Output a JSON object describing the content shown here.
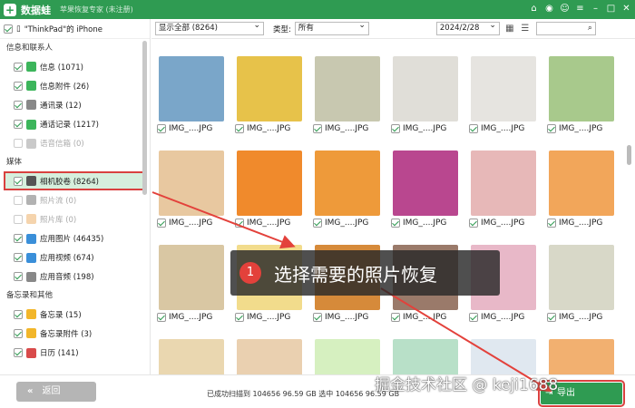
{
  "app": {
    "name": "数据蛙",
    "subtitle": "苹果恢复专家 (未注册)"
  },
  "device": {
    "label": "\"ThinkPad\"的 iPhone"
  },
  "sidebar": {
    "sections": [
      {
        "title": "信息和联系人",
        "items": [
          {
            "label": "信息 (1071)",
            "checked": true,
            "dim": false,
            "color": "#3cb55b"
          },
          {
            "label": "信息附件 (26)",
            "checked": true,
            "dim": false,
            "color": "#3cb55b"
          },
          {
            "label": "通讯录 (12)",
            "checked": true,
            "dim": false,
            "color": "#888888"
          },
          {
            "label": "通话记录 (1217)",
            "checked": true,
            "dim": false,
            "color": "#3cb55b"
          },
          {
            "label": "语音信箱 (0)",
            "checked": false,
            "dim": true,
            "color": "#888888"
          }
        ]
      },
      {
        "title": "媒体",
        "items": [
          {
            "label": "相机胶卷 (8264)",
            "checked": true,
            "dim": false,
            "selected": true,
            "color": "#555555"
          },
          {
            "label": "照片流 (0)",
            "checked": false,
            "dim": true,
            "color": "#555555"
          },
          {
            "label": "照片库 (0)",
            "checked": false,
            "dim": true,
            "color": "#e8a04a"
          },
          {
            "label": "应用图片 (46435)",
            "checked": true,
            "dim": false,
            "color": "#3a8fd9"
          },
          {
            "label": "应用视频 (674)",
            "checked": true,
            "dim": false,
            "color": "#3a8fd9"
          },
          {
            "label": "应用音频 (198)",
            "checked": true,
            "dim": false,
            "color": "#888888"
          }
        ]
      },
      {
        "title": "备忘录和其他",
        "items": [
          {
            "label": "备忘录 (15)",
            "checked": true,
            "dim": false,
            "color": "#f2b62a"
          },
          {
            "label": "备忘录附件 (3)",
            "checked": true,
            "dim": false,
            "color": "#f2b62a"
          },
          {
            "label": "日历 (141)",
            "checked": true,
            "dim": false,
            "color": "#d94b4b"
          }
        ]
      }
    ]
  },
  "toolbar": {
    "filter": "显示全部 (8264)",
    "type_label": "类型:",
    "type_value": "所有",
    "date": "2024/2/28",
    "view_grid_icon": "grid-view-icon",
    "view_list_icon": "list-view-icon",
    "search_icon": "search-icon"
  },
  "grid": {
    "caption": "IMG_....JPG",
    "thumb_colors": [
      "#7aa6c9",
      "#e7c24a",
      "#c8c8b0",
      "#e0ded8",
      "#e6e4e0",
      "#a8c98c",
      "#e8c8a0",
      "#f08a2c",
      "#ee9a3a",
      "#b9478f",
      "#e7b8b8",
      "#f2a65a",
      "#d9c7a3",
      "#f2dc8c",
      "#d68a3a",
      "#9a7a6a",
      "#e8b8c8",
      "#d8d8c8",
      "#ead7b0",
      "#ead0b0",
      "#d6f0c0",
      "#b8e0c8",
      "#e0e8f0",
      "#f2b070"
    ]
  },
  "bottom": {
    "back_label": "返回",
    "status": "已成功扫描到 104656 96.59 GB  选中 104656 96.59 GB",
    "export_label": "导出",
    "watermark": "掘金技术社区 @ keji1688"
  },
  "tooltip": {
    "step": "1",
    "text": "选择需要的照片恢复"
  },
  "colors": {
    "brand": "#2f9b52",
    "highlight": "#d9413f"
  }
}
